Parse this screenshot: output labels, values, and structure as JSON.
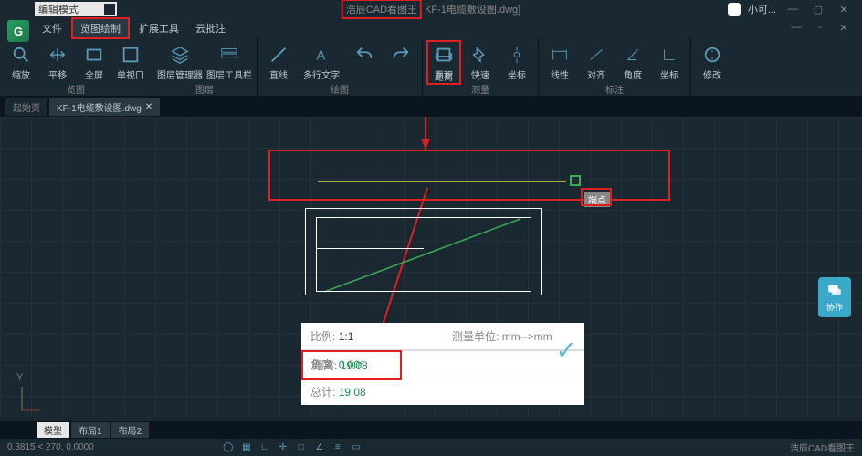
{
  "app": {
    "mode": "编辑模式",
    "title_product": "浩辰CAD看图王",
    "title_file": "KF-1电缆敷设图.dwg]",
    "user": "小可..."
  },
  "menu": {
    "file": "文件",
    "view_draw": "览图绘制",
    "ext_tools": "扩展工具",
    "cloud_annot": "云批注"
  },
  "ribbon": {
    "zoom": "缩放",
    "pan": "平移",
    "fullscreen": "全屏",
    "viewport": "单视口",
    "layer_mgr": "图层管理器",
    "layer_toolbar": "图层工具栏",
    "line": "直线",
    "mtext": "多行文字",
    "distance": "距离",
    "area": "面积",
    "quick": "快速",
    "seat": "坐标",
    "linear": "线性",
    "align": "对齐",
    "angle": "角度",
    "coord": "坐标",
    "modify": "修改",
    "g_view": "览图",
    "g_layer": "图层",
    "g_draw": "绘图",
    "g_measure": "测量",
    "g_annot": "标注"
  },
  "tabs": {
    "start": "起始页",
    "doc1": "KF-1电缆敷设图.dwg"
  },
  "measure": {
    "scale_label": "比例:",
    "scale_val": "1:1",
    "unit_label": "测量单位:",
    "unit_val": "mm-->mm",
    "dist_label": "距离:",
    "dist_val": "19.08",
    "angle_label": "角度:",
    "angle_val": "0.00°",
    "total_label": "总计:",
    "total_val": "19.08"
  },
  "canvas": {
    "endpoint_tip": "端点",
    "coord_y": "Y"
  },
  "bottom": {
    "model": "模型",
    "layout1": "布局1",
    "layout2": "布局2"
  },
  "status": {
    "coords": "0.3815 < 270, 0.0000",
    "brand": "浩辰CAD看图王"
  },
  "float": {
    "label": "协作"
  }
}
